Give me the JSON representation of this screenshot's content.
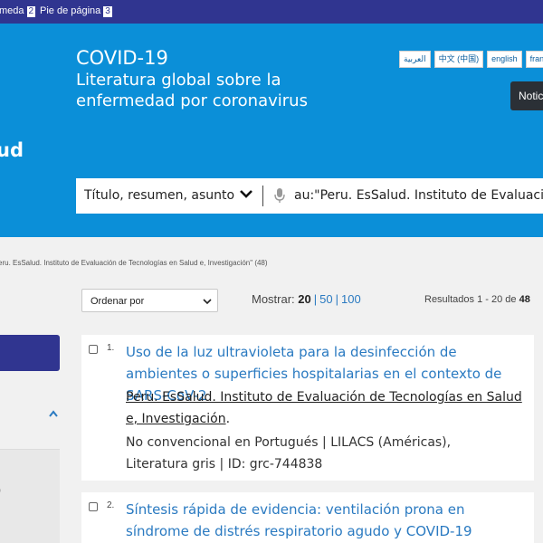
{
  "skip_links": [
    {
      "label": "meda",
      "key": "2"
    },
    {
      "label": "Pie de página",
      "key": "3"
    }
  ],
  "header": {
    "title": "COVID-19",
    "subtitle": "Literatura global sobre la enfermedad por coronavirus",
    "brand_fragment": "ud",
    "languages": [
      "العربية",
      "中文 (中国)",
      "english",
      "franç"
    ],
    "notice_button": "Notic"
  },
  "search": {
    "field": "Título, resumen, asunto",
    "query": "au:\"Peru. EsSalud. Instituto de Evaluació"
  },
  "breadcrumb": "eru. EsSalud. Instituto de Evaluación de Tecnologías en Salud e, Investigación\" (48)",
  "controls": {
    "sort_label": "Ordenar por",
    "show_label": "Mostrar:",
    "page_sizes": [
      "20",
      "50",
      "100"
    ],
    "results_prefix": "Resultados 1 - 20 de ",
    "results_total": "48"
  },
  "left_panel": {
    "fragment": ")"
  },
  "results": [
    {
      "index": "1.",
      "title": "Uso de la luz ultravioleta para la desinfección de ambientes o superficies hospitalarias en el contexto de SARS-CoV-2",
      "author": "Peru. EsSalud. Instituto de Evaluación de Tecnologías en Salud e, Investigación",
      "author_suffix": ".",
      "meta": "No convencional en Portugués | LILACS (Américas), Literatura gris | ID: grc-744838"
    },
    {
      "index": "2.",
      "title": "Síntesis rápida de evidencia: ventilación prona en síndrome de distrés respiratorio agudo y COVID-19"
    }
  ],
  "colors": {
    "topbar": "#303590",
    "hero": "#0b8fd8",
    "link": "#2a7ac1",
    "page_bg": "#f1f1f1"
  }
}
